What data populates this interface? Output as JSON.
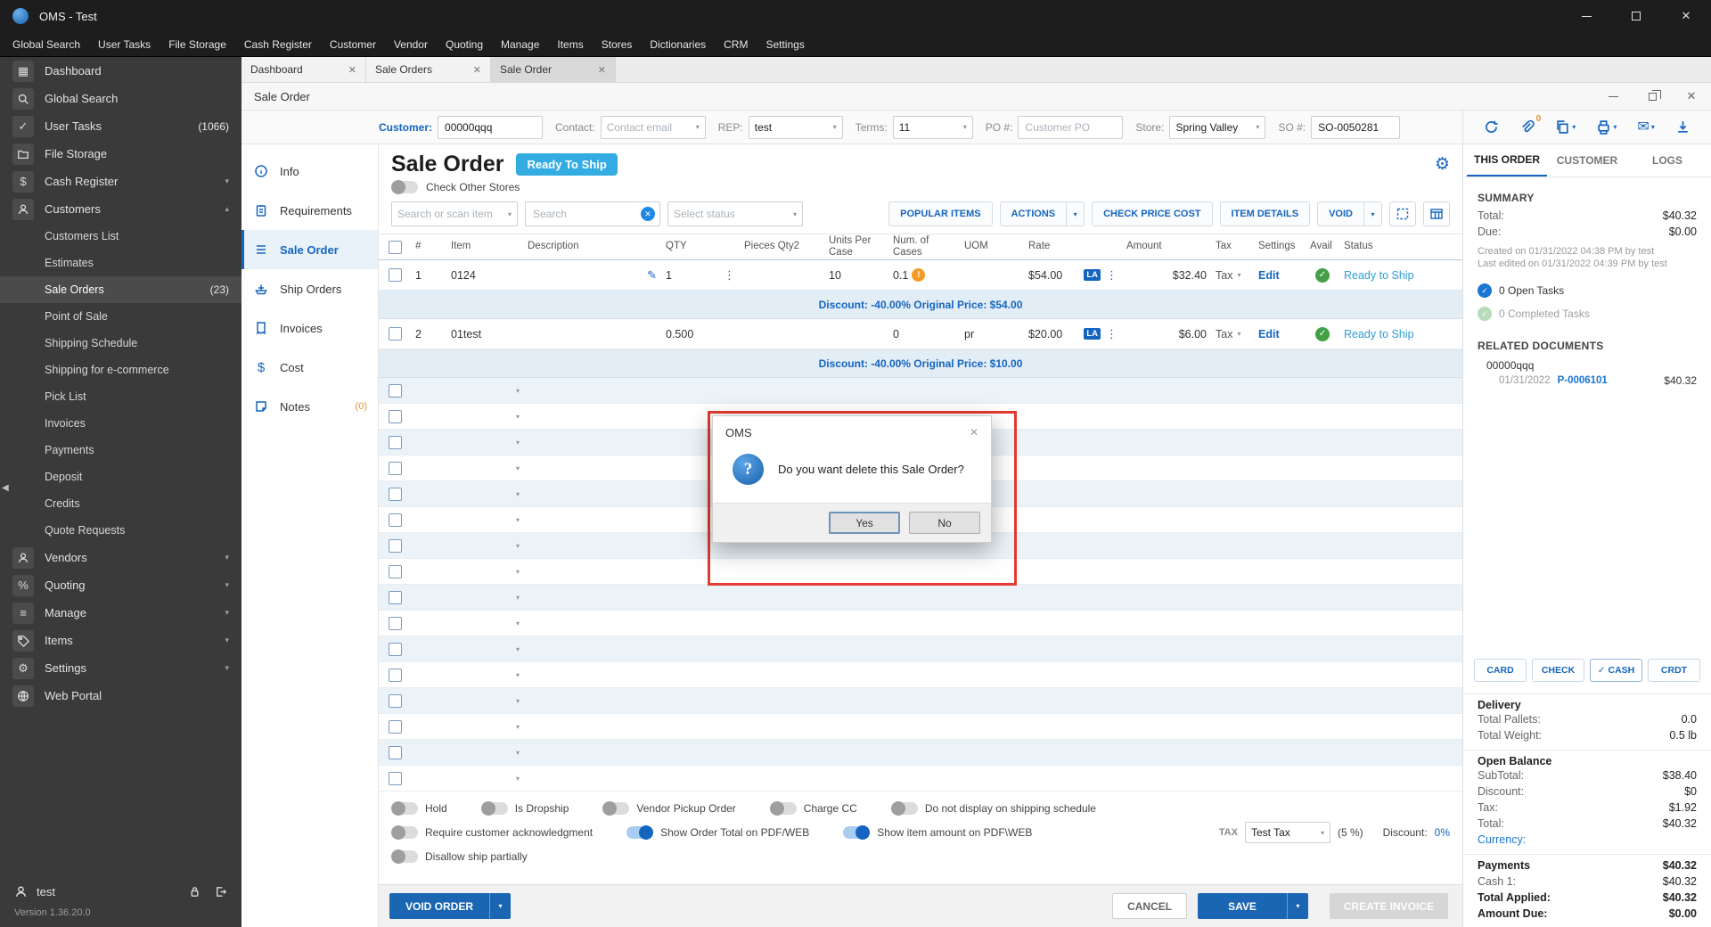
{
  "titlebar": {
    "title": "OMS - Test"
  },
  "menubar": {
    "items": [
      "Global Search",
      "User Tasks",
      "File Storage",
      "Cash Register",
      "Customer",
      "Vendor",
      "Quoting",
      "Manage",
      "Items",
      "Stores",
      "Dictionaries",
      "CRM",
      "Settings"
    ]
  },
  "sidebar": {
    "items": [
      {
        "label": "Dashboard"
      },
      {
        "label": "Global Search"
      },
      {
        "label": "User Tasks",
        "badge": "(1066)"
      },
      {
        "label": "File Storage"
      },
      {
        "label": "Cash Register"
      },
      {
        "label": "Customers"
      },
      {
        "label": "Vendors"
      },
      {
        "label": "Quoting"
      },
      {
        "label": "Manage"
      },
      {
        "label": "Items"
      },
      {
        "label": "Settings"
      },
      {
        "label": "Web Portal"
      }
    ],
    "customers_sub": [
      {
        "label": "Customers List"
      },
      {
        "label": "Estimates"
      },
      {
        "label": "Sale Orders",
        "badge": "(23)"
      },
      {
        "label": "Point of Sale"
      },
      {
        "label": "Shipping Schedule"
      },
      {
        "label": "Shipping for e-commerce"
      },
      {
        "label": "Pick List"
      },
      {
        "label": "Invoices"
      },
      {
        "label": "Payments"
      },
      {
        "label": "Deposit"
      },
      {
        "label": "Credits"
      },
      {
        "label": "Quote Requests"
      }
    ],
    "user": "test",
    "version": "Version 1.36.20.0"
  },
  "tabbar": {
    "tabs": [
      {
        "label": "Dashboard"
      },
      {
        "label": "Sale Orders"
      },
      {
        "label": "Sale Order"
      }
    ]
  },
  "inner_window": {
    "title": "Sale Order"
  },
  "form": {
    "customer": {
      "label": "Customer:",
      "value": "00000qqq"
    },
    "contact": {
      "label": "Contact:",
      "placeholder": "Contact email"
    },
    "rep": {
      "label": "REP:",
      "value": "test"
    },
    "terms": {
      "label": "Terms:",
      "value": "11"
    },
    "po": {
      "label": "PO #:",
      "placeholder": "Customer PO"
    },
    "store": {
      "label": "Store:",
      "value": "Spring Valley"
    },
    "so": {
      "label": "SO #:",
      "value": "SO-0050281"
    }
  },
  "toolbar_icons": {
    "attach_count": "0"
  },
  "nav": {
    "items": [
      {
        "label": "Info"
      },
      {
        "label": "Requirements"
      },
      {
        "label": "Sale Order"
      },
      {
        "label": "Ship Orders"
      },
      {
        "label": "Invoices"
      },
      {
        "label": "Cost"
      },
      {
        "label": "Notes",
        "badge": "(0)"
      }
    ]
  },
  "order": {
    "title": "Sale Order",
    "status": "Ready To Ship",
    "check_other_stores": "Check Other Stores",
    "search_item_placeholder": "Search or scan item",
    "search_placeholder": "Search",
    "status_placeholder": "Select status",
    "btn_popular": "POPULAR ITEMS",
    "btn_actions": "ACTIONS",
    "btn_check_price": "CHECK PRICE COST",
    "btn_item_details": "ITEM DETAILS",
    "btn_void": "VOID"
  },
  "table": {
    "columns": [
      "#",
      "Item",
      "Description",
      "QTY",
      "Pieces Qty2",
      "Units Per Case",
      "Num. of Cases",
      "UOM",
      "Rate",
      "Amount",
      "Tax",
      "Settings",
      "Avail",
      "Status"
    ],
    "rows": [
      {
        "num": "1",
        "item": "0124",
        "qty": "1",
        "units_per_case": "10",
        "num_cases": "0.1",
        "uom": "",
        "rate": "$54.00",
        "uom_badge": "LA",
        "amount": "$32.40",
        "tax": "Tax",
        "settings": "Edit",
        "status": "Ready to Ship",
        "discount": "Discount: -40.00% Original Price: $54.00"
      },
      {
        "num": "2",
        "item": "01test",
        "qty": "0.500",
        "units_per_case": "",
        "num_cases": "0",
        "uom": "pr",
        "rate": "$20.00",
        "uom_badge": "LA",
        "amount": "$6.00",
        "tax": "Tax",
        "settings": "Edit",
        "status": "Ready to Ship",
        "discount": "Discount: -40.00% Original Price: $10.00"
      }
    ]
  },
  "dialog": {
    "title": "OMS",
    "message": "Do you want delete this Sale Order?",
    "yes_label": "Yes",
    "no_label": "No"
  },
  "footer": {
    "toggles": {
      "hold": "Hold",
      "is_dropship": "Is Dropship",
      "vendor_pickup": "Vendor Pickup Order",
      "charge_cc": "Charge CC",
      "no_shipping_schedule": "Do not display on shipping schedule",
      "require_ack": "Require customer acknowledgment",
      "show_order_total": "Show Order Total on PDF/WEB",
      "show_item_amount": "Show item amount on PDF\\WEB",
      "disallow_partial": "Disallow ship partially"
    },
    "tax_label": "TAX",
    "tax_value": "Test Tax",
    "tax_pct": "(5 %)",
    "discount_label": "Discount:",
    "discount_value": "0%",
    "btn_void_order": "VOID ORDER",
    "btn_cancel": "CANCEL",
    "btn_save": "SAVE",
    "btn_create_invoice": "CREATE INVOICE"
  },
  "panel": {
    "tabs": [
      "THIS ORDER",
      "CUSTOMER",
      "LOGS"
    ],
    "summary": {
      "heading": "SUMMARY",
      "total_label": "Total:",
      "total": "$40.32",
      "due_label": "Due:",
      "due": "$0.00",
      "created": "Created on 01/31/2022 04:38 PM by test",
      "edited": "Last edited on 01/31/2022 04:39 PM by test",
      "open_tasks": "0 Open Tasks",
      "completed_tasks": "0 Completed Tasks"
    },
    "related": {
      "heading": "RELATED DOCUMENTS",
      "customer": "00000qqq",
      "date": "01/31/2022",
      "doc": "P-0006101",
      "amount": "$40.32"
    },
    "pay_buttons": {
      "card": "CARD",
      "check": "CHECK",
      "cash": "CASH",
      "crdt": "CRDT"
    },
    "delivery": {
      "heading": "Delivery",
      "pallets_label": "Total Pallets:",
      "pallets": "0.0",
      "weight_label": "Total Weight:",
      "weight": "0.5 lb"
    },
    "balance": {
      "heading": "Open Balance",
      "subtotal_label": "SubTotal:",
      "subtotal": "$38.40",
      "discount_label": "Discount:",
      "discount": "$0",
      "tax_label": "Tax:",
      "tax": "$1.92",
      "total_label": "Total:",
      "total": "$40.32",
      "currency_label": "Currency:"
    },
    "payments": {
      "heading": "Payments",
      "total": "$40.32",
      "cash1_label": "Cash 1:",
      "cash1": "$40.32",
      "applied_label": "Total Applied:",
      "applied": "$40.32",
      "due_label": "Amount Due:",
      "due": "$0.00"
    }
  },
  "icons": {
    "dashboard": "▦",
    "tasks": "✓",
    "storage": "▤",
    "cash": "$",
    "quoting": "%",
    "manage": "≡",
    "settings": "⚙",
    "gear": "⚙",
    "mail": "✉",
    "pencil": "✎",
    "kebab": "⋮",
    "chevron_down": "▾",
    "chevron_up": "▴",
    "collapse": "◀",
    "close": "✕",
    "check": "✓",
    "warn": "!",
    "info_glyph": "≡",
    "cost": "$",
    "notes": "✎",
    "question": "?"
  }
}
